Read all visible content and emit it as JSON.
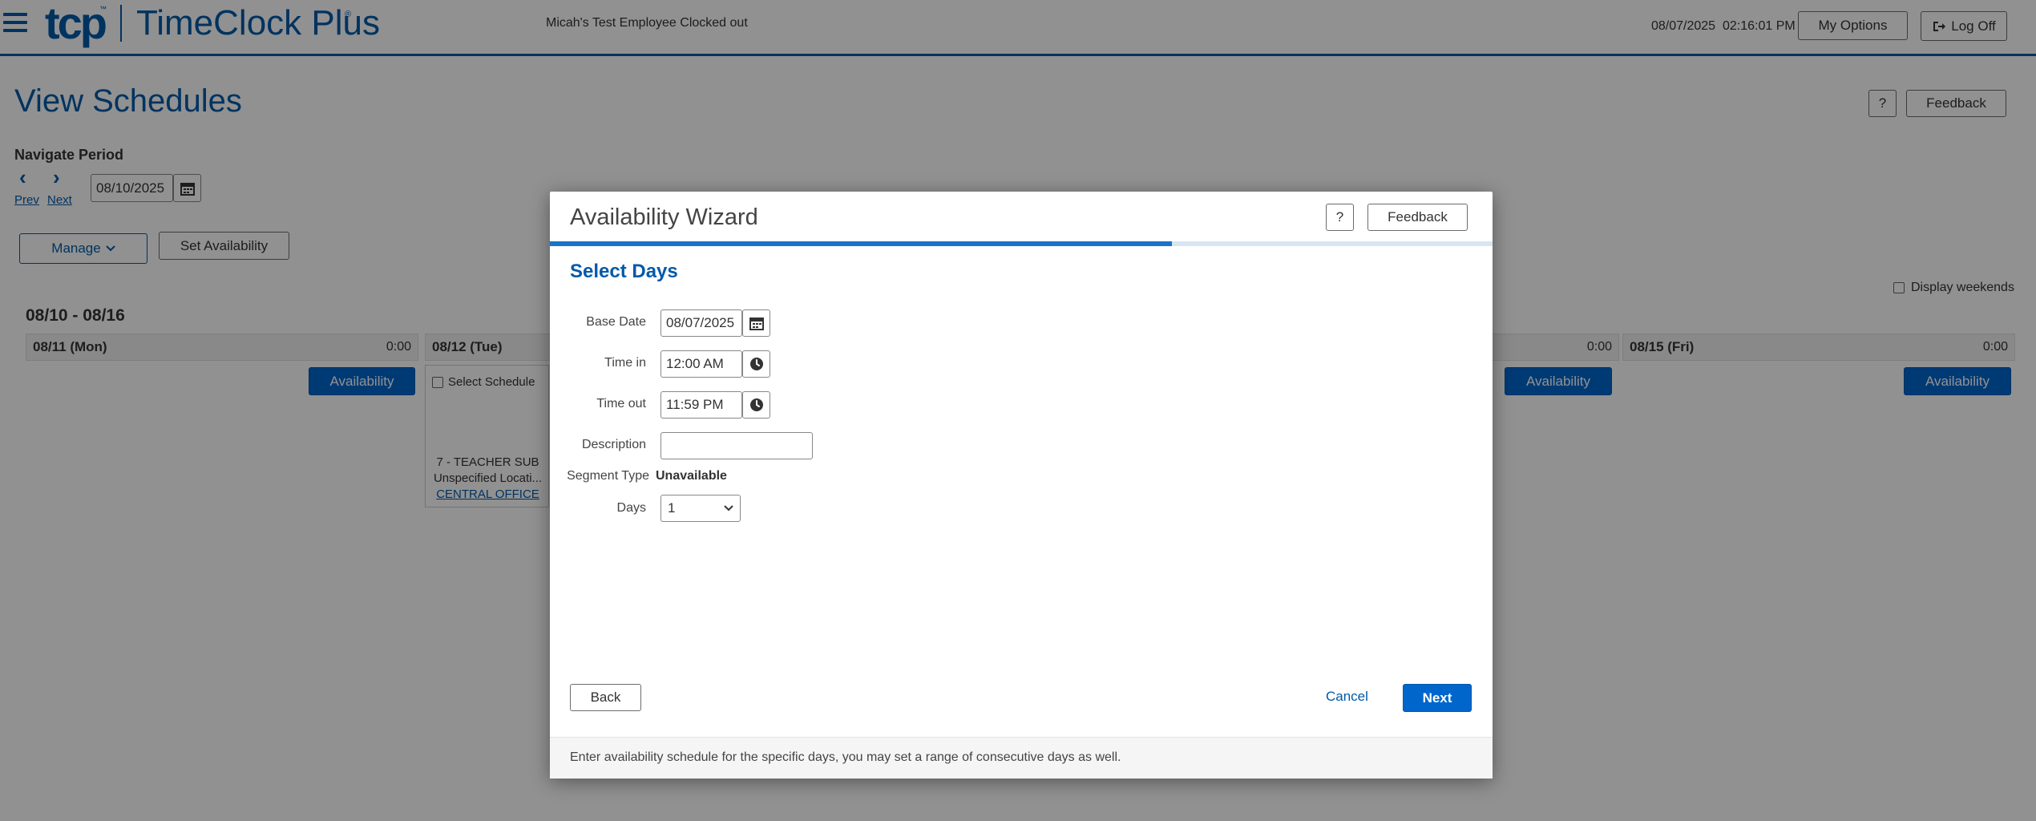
{
  "header": {
    "logo_mark": "tcp",
    "logo_tm": "™",
    "app_name": "TimeClock Plus",
    "app_reg": "®",
    "status": "Micah's Test Employee Clocked out",
    "date": "08/07/2025",
    "time": "02:16:01 PM",
    "my_options": "My Options",
    "log_off": "Log Off"
  },
  "page": {
    "title": "View Schedules",
    "help": "?",
    "feedback": "Feedback",
    "navigate_label": "Navigate Period",
    "prev": "Prev",
    "next": "Next",
    "period_date": "08/10/2025",
    "manage": "Manage",
    "set_availability": "Set Availability",
    "display_weekends": "Display weekends",
    "week_range": "08/10 - 08/16",
    "days": [
      {
        "label": "08/11 (Mon)",
        "total": "0:00",
        "action": "Availability"
      },
      {
        "label": "08/12 (Tue)",
        "total": "",
        "action": ""
      },
      {
        "label": "",
        "total": "0:00",
        "action": "Availability"
      },
      {
        "label": "08/15 (Fri)",
        "total": "0:00",
        "action": "Availability"
      }
    ],
    "schedule_card": {
      "select_label": "Select Schedule",
      "job": "7 - TEACHER SUB",
      "location": "Unspecified Locati...",
      "office": "CENTRAL OFFICE"
    }
  },
  "modal": {
    "title": "Availability Wizard",
    "help": "?",
    "feedback": "Feedback",
    "progress_fraction": 0.66,
    "section": "Select Days",
    "base_date_label": "Base Date",
    "base_date": "08/07/2025",
    "time_in_label": "Time in",
    "time_in": "12:00 AM",
    "time_out_label": "Time out",
    "time_out": "11:59 PM",
    "description_label": "Description",
    "description": "",
    "segment_type_label": "Segment Type",
    "segment_type": "Unavailable",
    "days_label": "Days",
    "days_value": "1",
    "back": "Back",
    "cancel": "Cancel",
    "next": "Next",
    "footer": "Enter availability schedule for the specific days, you may set a range of consecutive days as well."
  },
  "colors": {
    "brand": "#005aa9",
    "primary_button": "#0066cc",
    "progress": "#1a73c7"
  }
}
